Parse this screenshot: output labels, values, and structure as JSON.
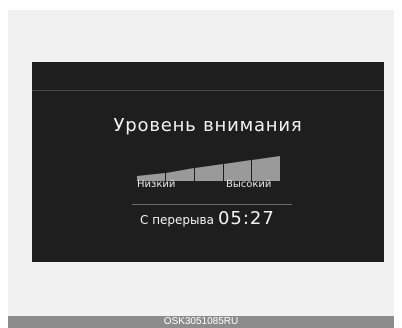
{
  "screen": {
    "title": "Уровень внимания",
    "level_label_low": "Низкий",
    "level_label_high": "Высокий",
    "since_break_label": "С перерыва",
    "since_break_time": "05:27",
    "attention_level_fraction": 1.0
  },
  "caption": {
    "code": "OSK3051085RU"
  },
  "colors": {
    "screen_bg": "#1e1e1e",
    "bar_fill": "#9a9a9a",
    "text": "#f2f2f2"
  }
}
